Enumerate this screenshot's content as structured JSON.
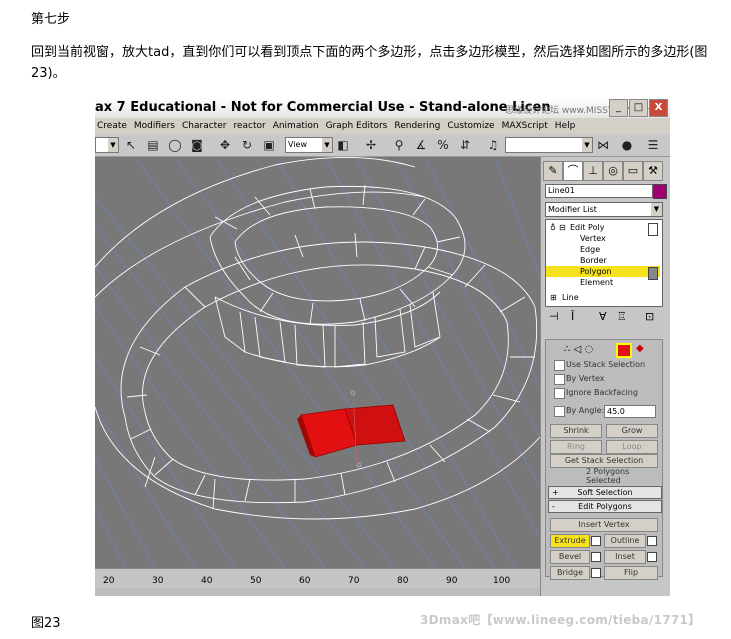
{
  "article": {
    "step_title": "第七步",
    "paragraph": "回到当前视窗，放大tad，直到你们可以看到顶点下面的两个多边形，点击多边形模型，然后选择如图所示的多边形(图23)。",
    "caption": "图23",
    "watermark": "3Dmax吧【www.lineeg.com/tieba/1771】"
  },
  "app": {
    "title": "ax 7  Educational - Not for Commercial Use - Stand-alone Licen",
    "titlebar_watermark": "思缘设计论坛  www.MISSYUAN.com",
    "window_buttons": [
      "_",
      "□",
      "X"
    ],
    "menu": [
      "Create",
      "Modifiers",
      "Character",
      "reactor",
      "Animation",
      "Graph Editors",
      "Rendering",
      "Customize",
      "MAXScript",
      "Help"
    ],
    "toolbar": {
      "refcoord": "View"
    },
    "timeline_ticks": [
      "20",
      "30",
      "40",
      "50",
      "60",
      "70",
      "80",
      "90",
      "100"
    ]
  },
  "command_panel": {
    "object_name": "Line01",
    "object_color": "#a00070",
    "modifier_list": "Modifier List",
    "stack": {
      "edit_poly": "Edit Poly",
      "sub": [
        "Vertex",
        "Edge",
        "Border",
        "Polygon",
        "Element"
      ],
      "line": "Line"
    },
    "selection": {
      "use_stack": "Use Stack Selection",
      "by_vertex": "By Vertex",
      "ignore_backfacing": "Ignore Backfacing",
      "by_angle": "By Angle:",
      "angle_value": "45.0",
      "shrink": "Shrink",
      "grow": "Grow",
      "ring": "Ring",
      "loop": "Loop",
      "get_stack": "Get Stack Selection",
      "count": "2 Polygons Selected"
    },
    "soft_selection": "Soft Selection",
    "edit_polygons": {
      "header": "Edit Polygons",
      "insert_vertex": "Insert Vertex",
      "extrude": "Extrude",
      "outline": "Outline",
      "bevel": "Bevel",
      "inset": "Inset",
      "bridge": "Bridge",
      "flip": "Flip"
    }
  },
  "colors": {
    "viewport": "#787878",
    "selected_polygon": "#e21010",
    "highlight": "#f6e21c"
  }
}
